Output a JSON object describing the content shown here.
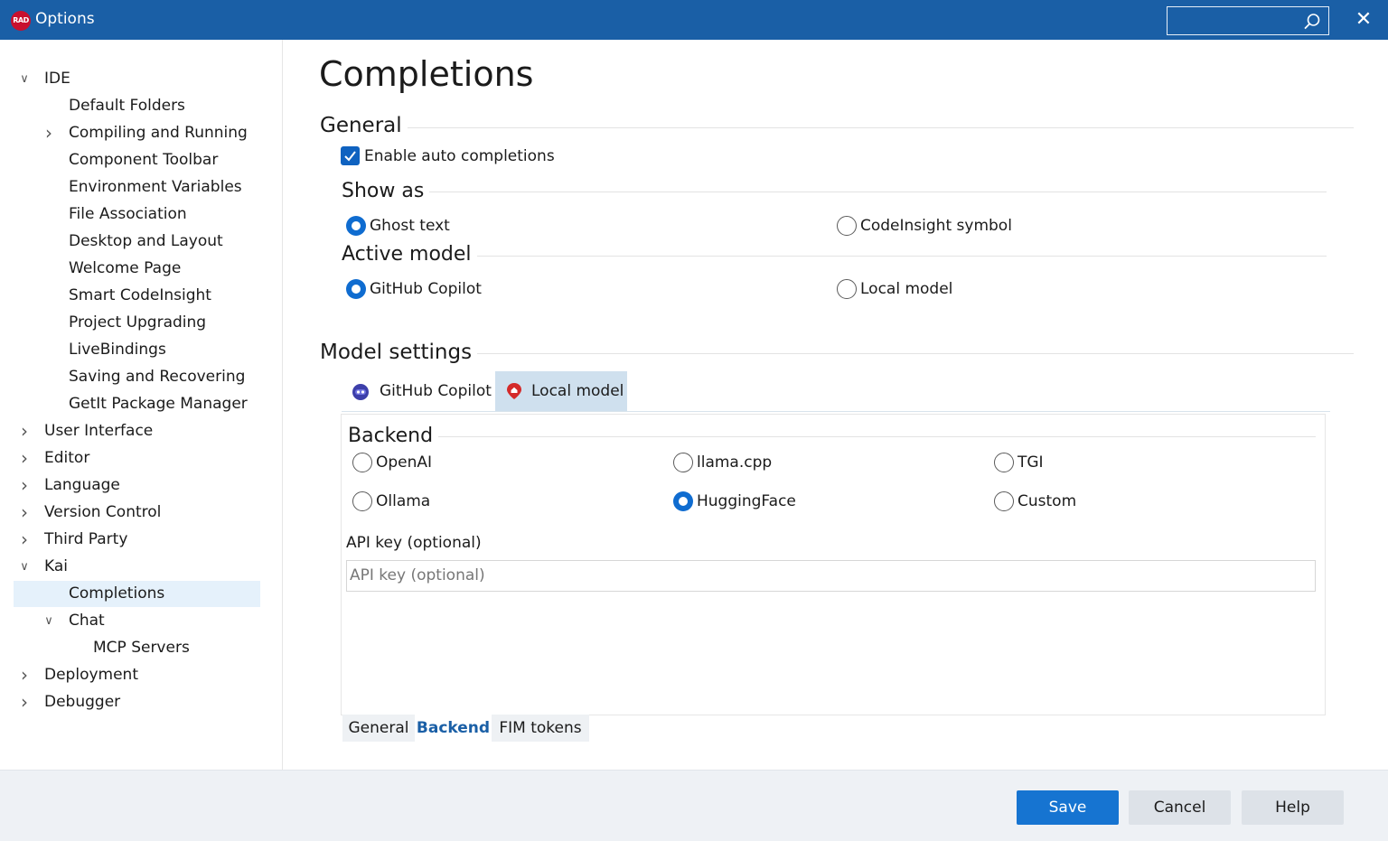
{
  "window": {
    "title": "Options",
    "logo_text": "RAD"
  },
  "sidebar": {
    "items": [
      {
        "label": "IDE",
        "chevron": "expanded"
      },
      {
        "label": "Default Folders",
        "chevron": ""
      },
      {
        "label": "Compiling and Running",
        "chevron": "collapsed"
      },
      {
        "label": "Component Toolbar",
        "chevron": ""
      },
      {
        "label": "Environment Variables",
        "chevron": ""
      },
      {
        "label": "File Association",
        "chevron": ""
      },
      {
        "label": "Desktop and Layout",
        "chevron": ""
      },
      {
        "label": "Welcome Page",
        "chevron": ""
      },
      {
        "label": "Smart CodeInsight",
        "chevron": ""
      },
      {
        "label": "Project Upgrading",
        "chevron": ""
      },
      {
        "label": "LiveBindings",
        "chevron": ""
      },
      {
        "label": "Saving and Recovering",
        "chevron": ""
      },
      {
        "label": "GetIt Package Manager",
        "chevron": ""
      },
      {
        "label": "User Interface",
        "chevron": "collapsed"
      },
      {
        "label": "Editor",
        "chevron": "collapsed"
      },
      {
        "label": "Language",
        "chevron": "collapsed"
      },
      {
        "label": "Version Control",
        "chevron": "collapsed"
      },
      {
        "label": "Third Party",
        "chevron": "collapsed"
      },
      {
        "label": "Kai",
        "chevron": "expanded"
      },
      {
        "label": "Completions",
        "chevron": "",
        "selected": true
      },
      {
        "label": "Chat",
        "chevron": "expanded"
      },
      {
        "label": "MCP Servers",
        "chevron": ""
      },
      {
        "label": "Deployment",
        "chevron": "collapsed"
      },
      {
        "label": "Debugger",
        "chevron": "collapsed"
      }
    ]
  },
  "main": {
    "title": "Completions",
    "general": {
      "label": "General",
      "enable_auto_completions": {
        "label": "Enable auto completions",
        "checked": true
      }
    },
    "show_as": {
      "label": "Show as",
      "options": [
        {
          "label": "Ghost text",
          "selected": true
        },
        {
          "label": "CodeInsight symbol",
          "selected": false
        }
      ]
    },
    "active_model": {
      "label": "Active model",
      "options": [
        {
          "label": "GitHub Copilot",
          "selected": true
        },
        {
          "label": "Local model",
          "selected": false
        }
      ]
    },
    "model_settings": {
      "label": "Model settings",
      "tabs": [
        {
          "label": "GitHub Copilot",
          "icon": "copilot-icon",
          "active": false
        },
        {
          "label": "Local model",
          "icon": "local-model-icon",
          "active": true
        }
      ],
      "backend": {
        "label": "Backend",
        "options": [
          {
            "label": "OpenAI",
            "selected": false
          },
          {
            "label": "llama.cpp",
            "selected": false
          },
          {
            "label": "TGI",
            "selected": false
          },
          {
            "label": "Ollama",
            "selected": false
          },
          {
            "label": "HuggingFace",
            "selected": true
          },
          {
            "label": "Custom",
            "selected": false
          }
        ]
      },
      "api_key": {
        "label": "API key (optional)",
        "value": "",
        "placeholder": "API key (optional)"
      },
      "bottom_tabs": [
        {
          "label": "General",
          "active": false
        },
        {
          "label": "Backend",
          "active": true
        },
        {
          "label": "FIM tokens",
          "active": false
        }
      ]
    }
  },
  "footer": {
    "save": "Save",
    "cancel": "Cancel",
    "help": "Help"
  },
  "colors": {
    "titlebar": "#1a5fa6",
    "accent": "#1674d1",
    "selection": "#e5f1fb"
  }
}
